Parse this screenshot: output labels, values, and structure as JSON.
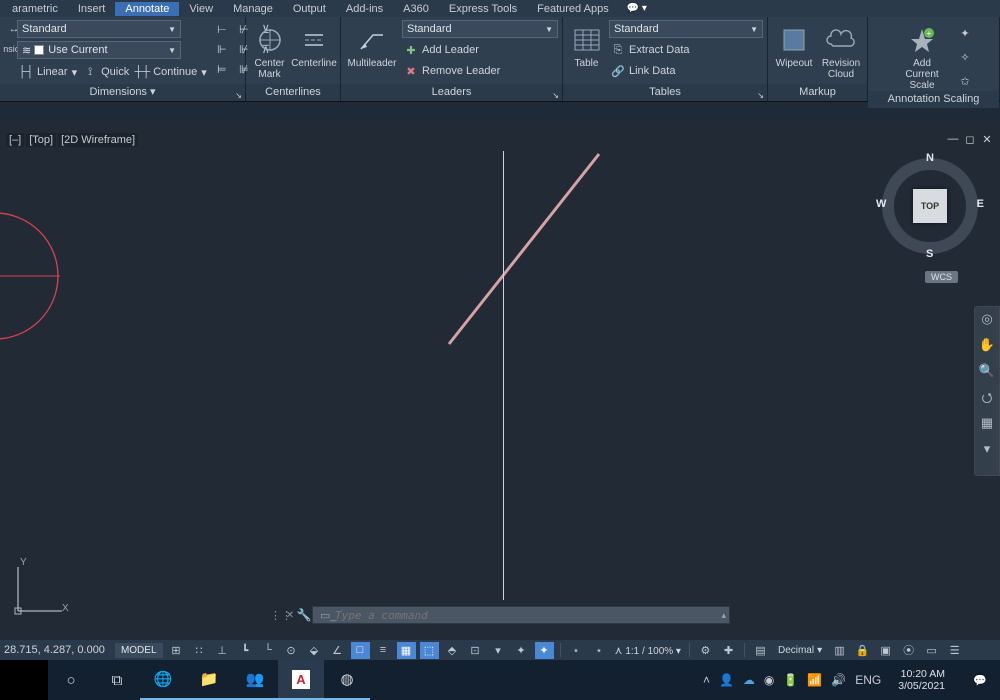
{
  "menu": {
    "items": [
      "arametric",
      "Insert",
      "Annotate",
      "View",
      "Manage",
      "Output",
      "Add-ins",
      "A360",
      "Express Tools",
      "Featured Apps"
    ],
    "active_index": 2
  },
  "ribbon": {
    "dimensions": {
      "style_combo": "Standard",
      "use_current": "Use Current",
      "linear": "Linear",
      "quick": "Quick",
      "continue": "Continue",
      "title": "Dimensions"
    },
    "centerlines": {
      "center_mark": "Center\nMark",
      "centerline": "Centerline",
      "title": "Centerlines"
    },
    "leaders": {
      "style_combo": "Standard",
      "multileader": "Multileader",
      "add_leader": "Add Leader",
      "remove_leader": "Remove Leader",
      "title": "Leaders"
    },
    "tables": {
      "style_combo": "Standard",
      "table": "Table",
      "extract": "Extract Data",
      "link": "Link Data",
      "title": "Tables"
    },
    "markup": {
      "wipeout": "Wipeout",
      "revcloud": "Revision\nCloud",
      "title": "Markup"
    },
    "annoscale": {
      "add_scale": "Add\nCurrent Scale",
      "title": "Annotation Scaling"
    }
  },
  "viewport": {
    "controls": [
      "[–]",
      "[Top]",
      "[2D Wireframe]"
    ],
    "viewcube": {
      "face": "TOP",
      "n": "N",
      "s": "S",
      "e": "E",
      "w": "W"
    },
    "wcs": "WCS",
    "ucs": {
      "x": "X",
      "y": "Y"
    }
  },
  "command": {
    "placeholder": "Type a command"
  },
  "status": {
    "coords": "28.715, 4.287, 0.000",
    "model": "MODEL",
    "anno_scale": "1:1 / 100%",
    "units": "Decimal"
  },
  "tray": {
    "lang": "ENG",
    "time": "10:20 AM",
    "date": "3/05/2021"
  }
}
